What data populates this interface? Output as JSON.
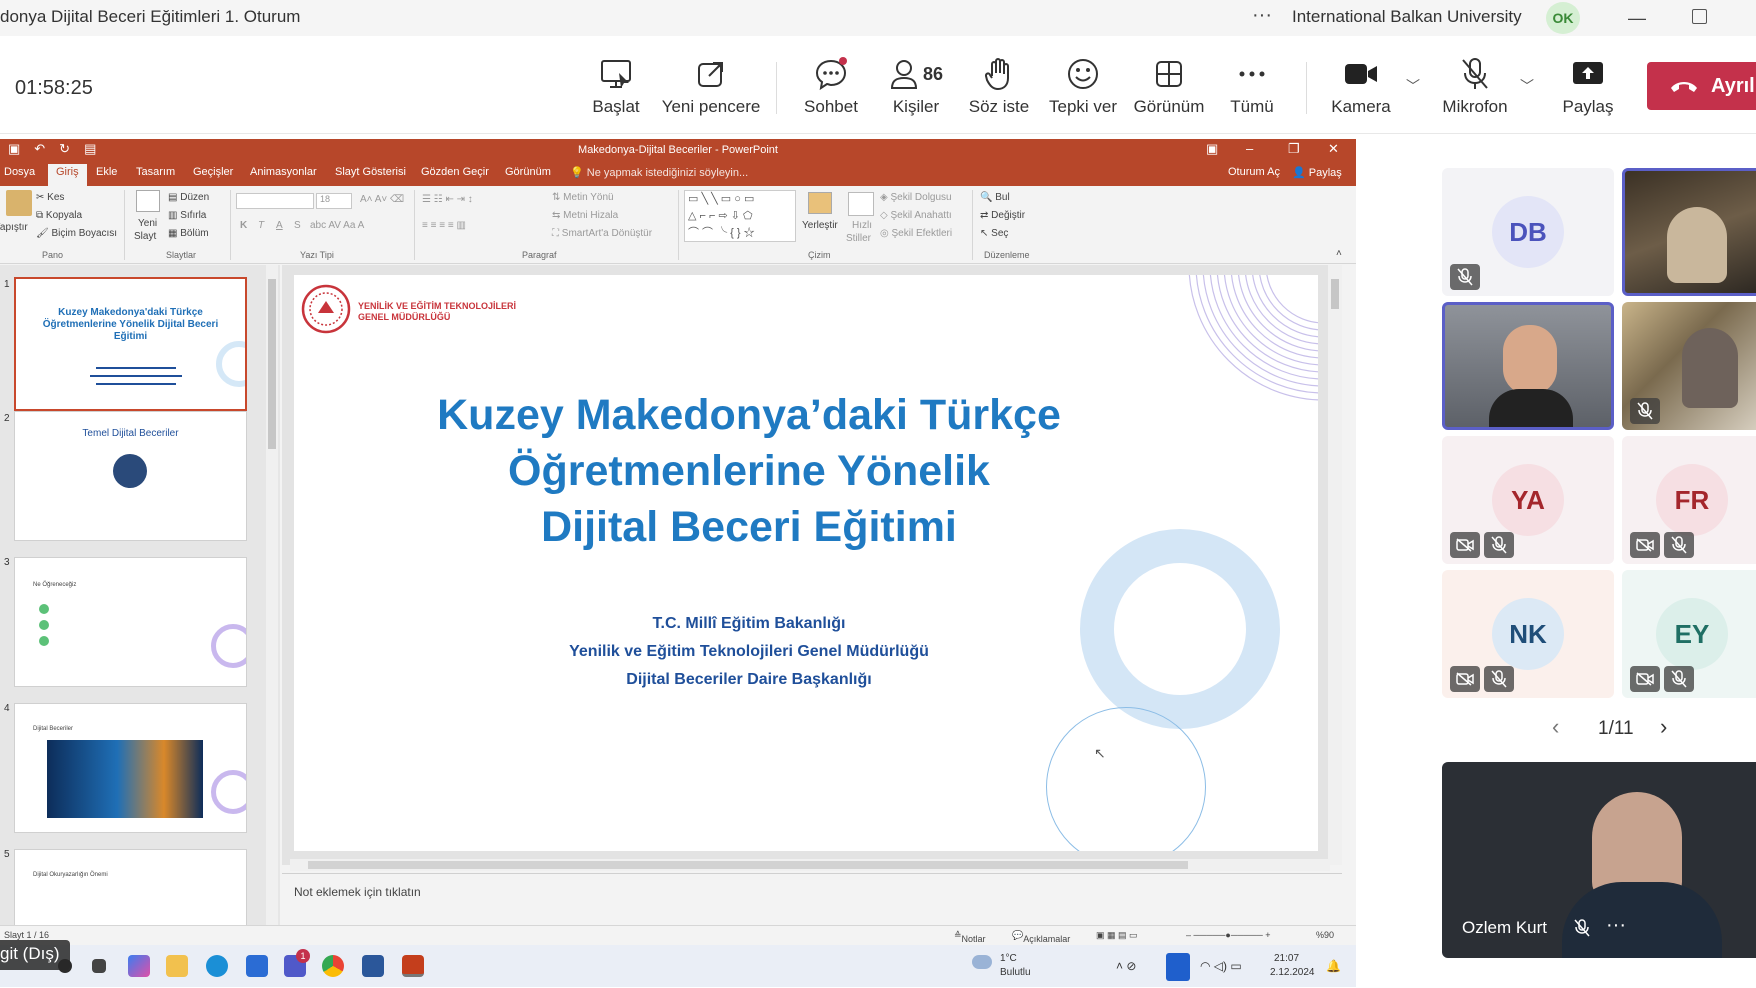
{
  "window": {
    "title": "donya Dijital Beceri Eğitimleri 1. Oturum",
    "more": "···",
    "organization": "International Balkan University",
    "user_initials": "OK"
  },
  "meeting_toolbar": {
    "timer": "01:58:25",
    "buttons": [
      {
        "label": "Başlat",
        "icon": "present-icon"
      },
      {
        "label": "Yeni pencere",
        "icon": "popout-icon"
      },
      {
        "label": "Sohbet",
        "icon": "chat-icon"
      },
      {
        "label": "Kişiler",
        "icon": "people-icon",
        "count": "86"
      },
      {
        "label": "Söz iste",
        "icon": "raise-hand-icon"
      },
      {
        "label": "Tepki ver",
        "icon": "emoji-icon"
      },
      {
        "label": "Görünüm",
        "icon": "view-grid-icon"
      },
      {
        "label": "Tümü",
        "icon": "more-icon"
      },
      {
        "label": "Kamera",
        "icon": "camera-icon"
      },
      {
        "label": "Mikrofon",
        "icon": "mic-off-icon"
      },
      {
        "label": "Paylaş",
        "icon": "share-icon"
      }
    ],
    "leave_label": "Ayrıl"
  },
  "powerpoint": {
    "doc_title": "Makedonya-Dijital Beceriler - PowerPoint",
    "tabs": [
      "Dosya",
      "Giriş",
      "Ekle",
      "Tasarım",
      "Geçişler",
      "Animasyonlar",
      "Slayt Gösterisi",
      "Gözden Geçir",
      "Görünüm"
    ],
    "active_tab": "Giriş",
    "tell_me": "Ne yapmak istediğinizi söyleyin...",
    "sign_in": "Oturum Aç",
    "share": "Paylaş",
    "ribbon": {
      "clipboard": {
        "paste": "Yapıştır",
        "cut": "Kes",
        "copy": "Kopyala",
        "format_painter": "Biçim Boyacısı",
        "group": "Pano"
      },
      "slides": {
        "new_slide_1": "Yeni",
        "new_slide_2": "Slayt",
        "layout": "Düzen",
        "reset": "Sıfırla",
        "section": "Bölüm",
        "group": "Slaytlar"
      },
      "font": {
        "size": "18",
        "group": "Yazı Tipi",
        "bold": "K",
        "italic": "T",
        "underline": "A",
        "strike": "S"
      },
      "paragraph": {
        "text_direction": "Metin Yönü",
        "align_text": "Metni Hizala",
        "smartart": "SmartArt'a Dönüştür",
        "group": "Paragraf"
      },
      "drawing": {
        "arrange": "Yerleştir",
        "quick_styles_1": "Hızlı",
        "quick_styles_2": "Stiller",
        "shape_fill": "Şekil Dolgusu",
        "shape_outline": "Şekil Anahattı",
        "shape_effects": "Şekil Efektleri",
        "group": "Çizim"
      },
      "editing": {
        "find": "Bul",
        "replace": "Değiştir",
        "select": "Seç",
        "group": "Düzenleme"
      }
    },
    "thumbnails": [
      {
        "num": "1",
        "title": "Kuzey Makedonya'daki Türkçe Öğretmenlerine Yönelik Dijital Beceri Eğitimi"
      },
      {
        "num": "2",
        "title": "Temel Dijital Beceriler"
      },
      {
        "num": "3",
        "title": "Ne Öğreneceğiz"
      },
      {
        "num": "4",
        "title": "Dijital Beceriler"
      },
      {
        "num": "5",
        "title": "Dijital Okuryazarlığın Önemi"
      }
    ],
    "slide": {
      "logo_line1": "YENİLİK VE EĞİTİM TEKNOLOJİLERİ",
      "logo_line2": "GENEL MÜDÜRLÜĞÜ",
      "title_line1": "Kuzey Makedonya’daki Türkçe",
      "title_line2": "Öğretmenlerine Yönelik",
      "title_line3": "Dijital Beceri Eğitimi",
      "subtitle1": "T.C. Millî Eğitim Bakanlığı",
      "subtitle2": "Yenilik ve Eğitim Teknolojileri Genel Müdürlüğü",
      "subtitle3": "Dijital Beceriler Daire Başkanlığı",
      "title_color": "#1f7ac2"
    },
    "notes_placeholder": "Not eklemek için tıklatın",
    "status": {
      "slide_info": "Slayt 1 / 16",
      "notes": "Notlar",
      "comments": "Açıklamalar",
      "zoom": "%90"
    }
  },
  "taskbar": {
    "weather_temp": "1°C",
    "weather_desc": "Bulutlu",
    "time": "21:07",
    "date": "2.12.2024",
    "teams_badge": "1"
  },
  "presenter_pill": "git (Dış)",
  "participants": [
    {
      "initials": "DB",
      "muted": true,
      "video": false,
      "bg": "#eef0fa",
      "fg": "#4b53bc"
    },
    {
      "initials": "",
      "muted": false,
      "video": true,
      "speaking": true
    },
    {
      "initials": "",
      "muted": false,
      "video": true,
      "speaking": true
    },
    {
      "initials": "",
      "muted": true,
      "video": true
    },
    {
      "initials": "YA",
      "muted": true,
      "video": false,
      "bg": "#f9eef0",
      "fg": "#a4262c"
    },
    {
      "initials": "FR",
      "muted": true,
      "video": false,
      "bg": "#f9eef0",
      "fg": "#a4262c"
    },
    {
      "initials": "NK",
      "muted": true,
      "video": false,
      "bg": "#fdf1ee",
      "fg": "#1f4e79"
    },
    {
      "initials": "EY",
      "muted": true,
      "video": false,
      "bg": "#eef7f5",
      "fg": "#1f6f64"
    }
  ],
  "pager": {
    "label": "1/11"
  },
  "self_view": {
    "name": "Ozlem Kurt"
  },
  "colors": {
    "accent": "#5b5fc7",
    "leave": "#c4314b",
    "ppt": "#b7472a"
  }
}
